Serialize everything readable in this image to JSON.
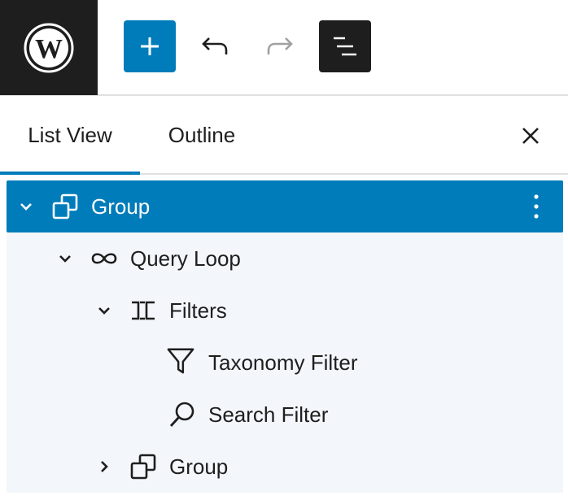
{
  "toolbar": {
    "logo_icon": "wordpress-logo-icon",
    "add_icon": "plus-icon",
    "undo_icon": "undo-icon",
    "redo_icon": "redo-icon",
    "list_view_icon": "list-view-icon",
    "accent_color": "#007cba",
    "dark_color": "#1e1e1e"
  },
  "tabs": [
    {
      "label": "List View",
      "active": true
    },
    {
      "label": "Outline",
      "active": false
    }
  ],
  "close_icon": "close-icon",
  "tree": [
    {
      "label": "Group",
      "icon": "group-icon",
      "level": 1,
      "expanded": true,
      "selected": true
    },
    {
      "label": "Query Loop",
      "icon": "loop-icon",
      "level": 2,
      "expanded": true,
      "selected": false
    },
    {
      "label": "Filters",
      "icon": "filters-icon",
      "level": 3,
      "expanded": true,
      "selected": false
    },
    {
      "label": "Taxonomy Filter",
      "icon": "funnel-icon",
      "level": 4,
      "expanded": null,
      "selected": false
    },
    {
      "label": "Search Filter",
      "icon": "search-icon",
      "level": 4,
      "expanded": null,
      "selected": false
    },
    {
      "label": "Group",
      "icon": "group-icon",
      "level": 3,
      "expanded": false,
      "selected": false
    }
  ]
}
